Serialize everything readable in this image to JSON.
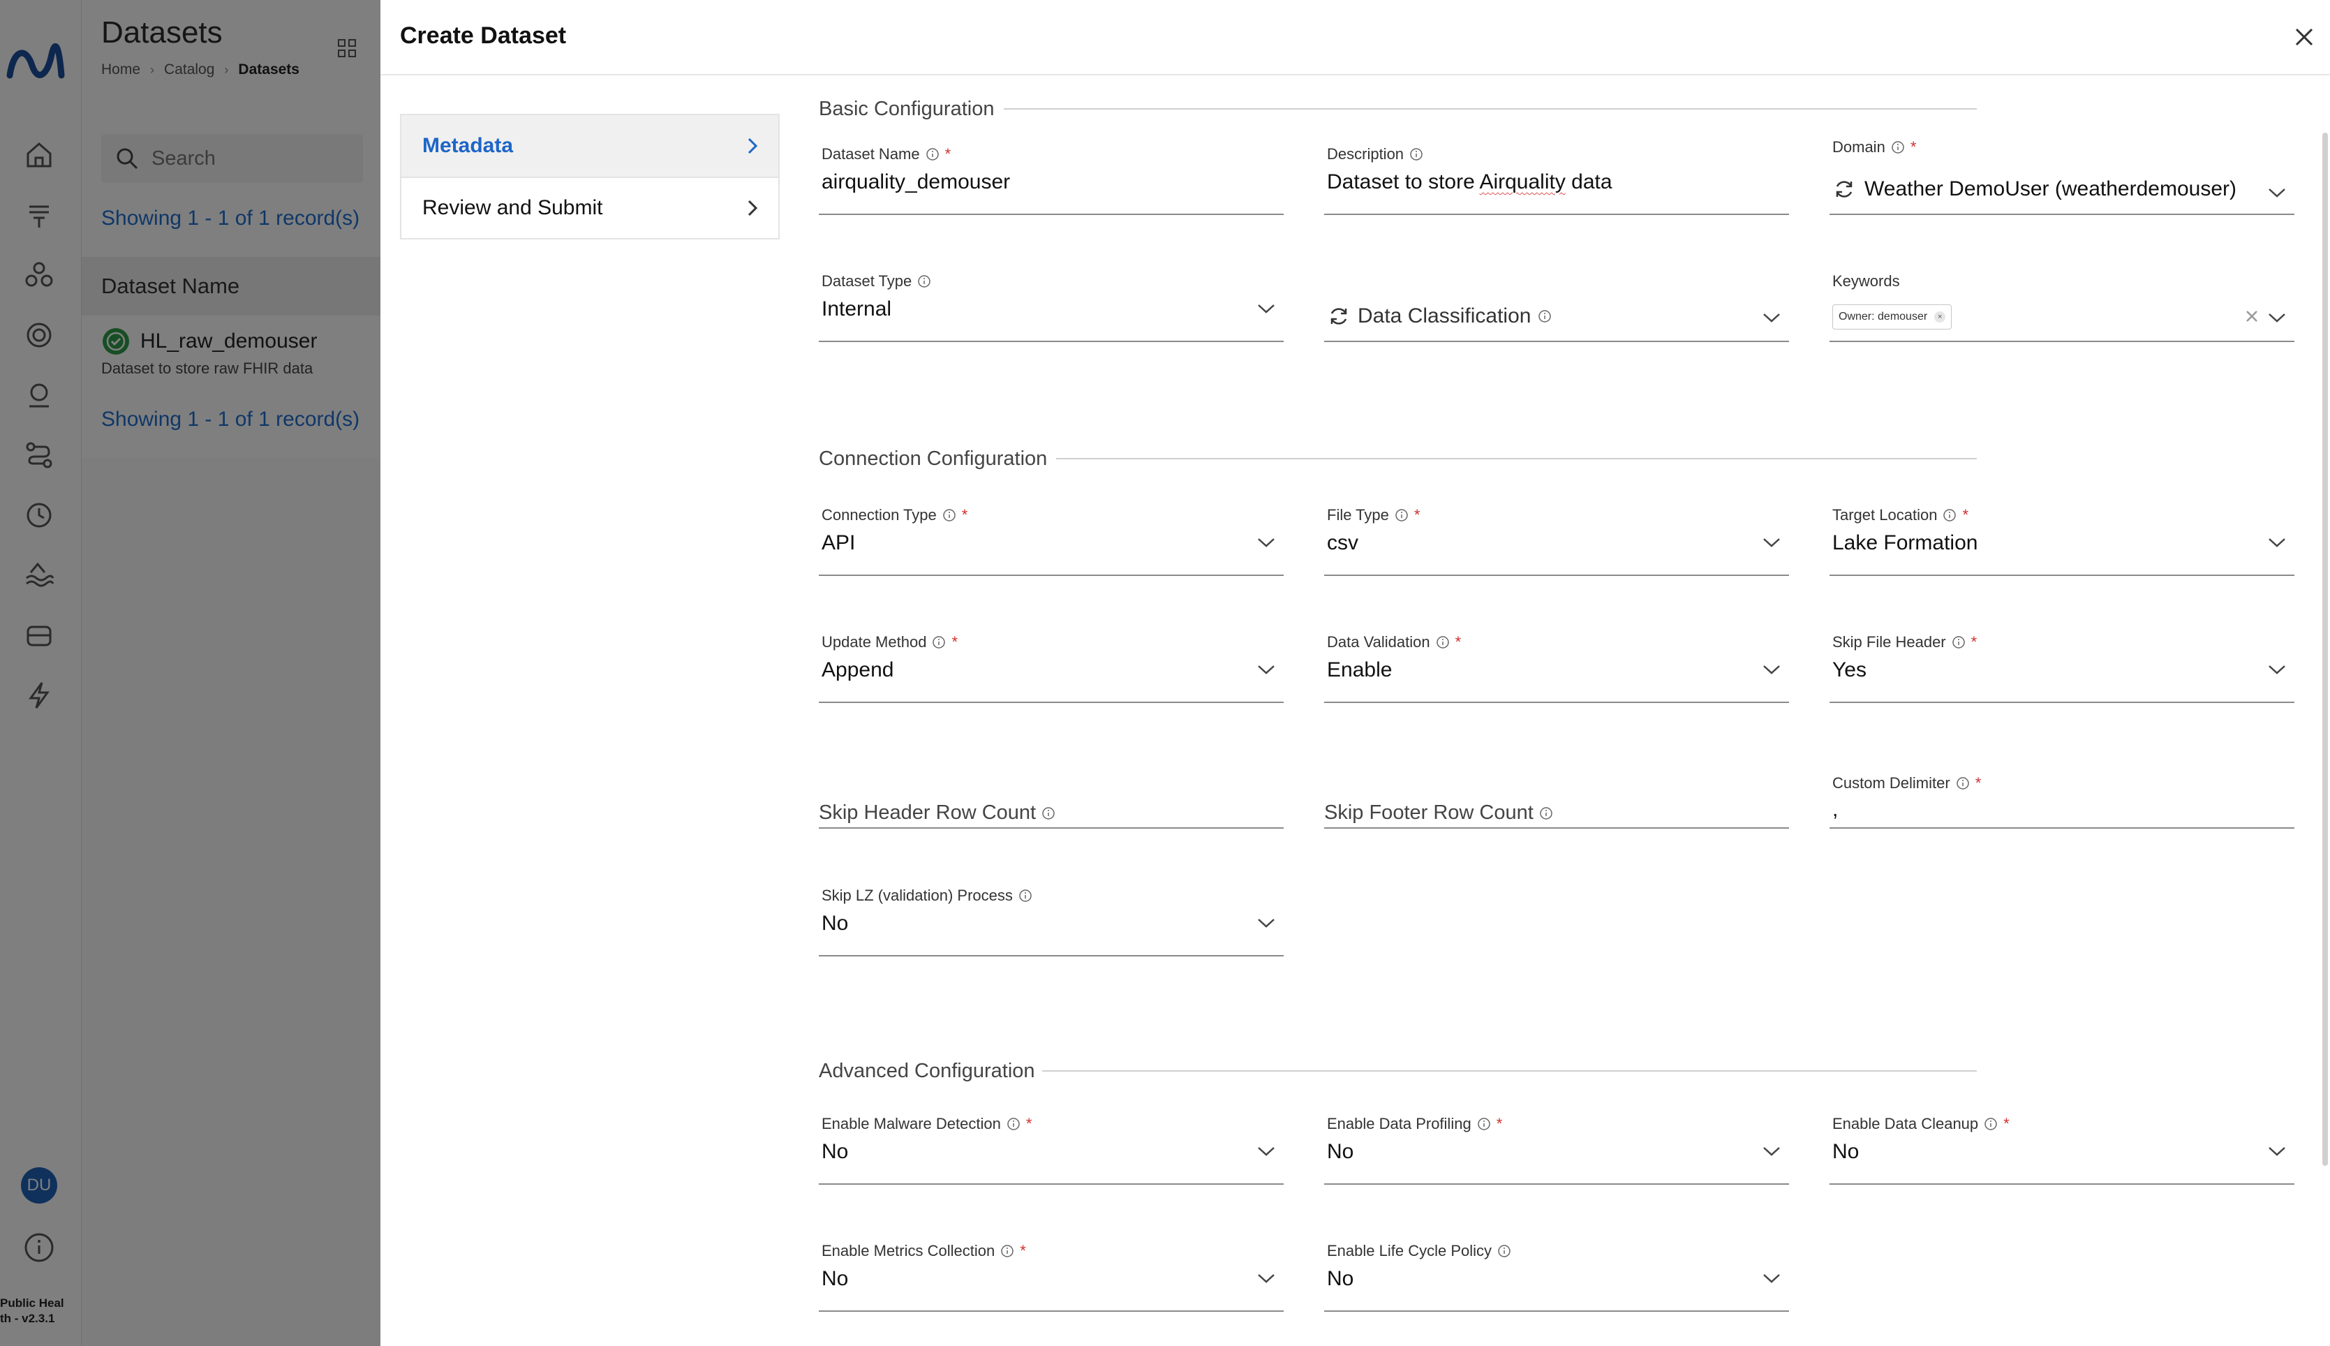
{
  "app": {
    "page_title": "Datasets",
    "breadcrumbs": [
      "Home",
      "Catalog",
      "Datasets"
    ],
    "search_placeholder": "Search",
    "record_count": "Showing 1 - 1 of 1 record(s)",
    "column_header": "Dataset Name",
    "dataset_row": {
      "name": "HL_raw_demouser",
      "description": "Dataset to store raw FHIR data"
    },
    "user_initials": "DU",
    "version_line1": "Public Heal",
    "version_line2": "th - v2.3.1"
  },
  "drawer": {
    "title": "Create Dataset",
    "steps": [
      {
        "label": "Metadata",
        "active": true
      },
      {
        "label": "Review and Submit",
        "active": false
      }
    ]
  },
  "sections": {
    "basic": "Basic Configuration",
    "connection": "Connection Configuration",
    "advanced": "Advanced Configuration"
  },
  "fields": {
    "dataset_name": {
      "label": "Dataset Name",
      "value": "airquality_demouser"
    },
    "description": {
      "label": "Description",
      "value_pre": "Dataset to store ",
      "value_spell": "Airquality",
      "value_post": " data"
    },
    "domain": {
      "label": "Domain",
      "value": "Weather DemoUser (weatherdemouser)"
    },
    "dataset_type": {
      "label": "Dataset Type",
      "value": "Internal"
    },
    "data_classification": {
      "placeholder": "Data Classification"
    },
    "keywords": {
      "label": "Keywords",
      "chips": [
        "Owner: demouser"
      ]
    },
    "connection_type": {
      "label": "Connection Type",
      "value": "API"
    },
    "file_type": {
      "label": "File Type",
      "value": "csv"
    },
    "target_location": {
      "label": "Target Location",
      "value": "Lake Formation"
    },
    "update_method": {
      "label": "Update Method",
      "value": "Append"
    },
    "data_validation": {
      "label": "Data Validation",
      "value": "Enable"
    },
    "skip_file_header": {
      "label": "Skip File Header",
      "value": "Yes"
    },
    "skip_header_row_count": {
      "placeholder": "Skip Header Row Count"
    },
    "skip_footer_row_count": {
      "placeholder": "Skip Footer Row Count"
    },
    "custom_delimiter": {
      "label": "Custom Delimiter",
      "value": ","
    },
    "skip_lz_process": {
      "label": "Skip LZ (validation) Process",
      "value": "No"
    },
    "enable_malware_detection": {
      "label": "Enable Malware Detection",
      "value": "No"
    },
    "enable_data_profiling": {
      "label": "Enable Data Profiling",
      "value": "No"
    },
    "enable_data_cleanup": {
      "label": "Enable Data Cleanup",
      "value": "No"
    },
    "enable_metrics_collection": {
      "label": "Enable Metrics Collection",
      "value": "No"
    },
    "enable_life_cycle_policy": {
      "label": "Enable Life Cycle Policy",
      "value": "No"
    }
  },
  "required_marker": "*",
  "colors": {
    "accent": "#1e66c7",
    "required": "#d32f2f",
    "overlay": "rgba(0,0,0,0.5)"
  }
}
